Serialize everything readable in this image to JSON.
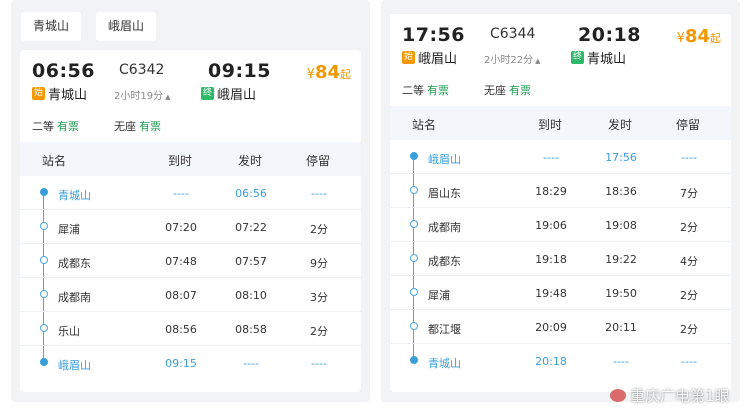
{
  "left": {
    "chips": [
      "青城山",
      "峨眉山"
    ],
    "depart_time": "06:56",
    "train_no": "C6342",
    "arrive_time": "09:15",
    "duration": "2小时19分",
    "price": {
      "symbol": "¥",
      "amount": "84",
      "suffix": "起"
    },
    "from_station": "青城山",
    "from_badge": "始",
    "to_station": "峨眉山",
    "to_badge": "终",
    "seats": [
      {
        "label": "二等",
        "status": "有票"
      },
      {
        "label": "无座",
        "status": "有票"
      }
    ],
    "headers": {
      "name": "站名",
      "arrive": "到时",
      "depart": "发时",
      "stay": "停留"
    },
    "stops": [
      {
        "name": "青城山",
        "arrive": "----",
        "depart": "06:56",
        "stay": "----"
      },
      {
        "name": "犀浦",
        "arrive": "07:20",
        "depart": "07:22",
        "stay": "2分"
      },
      {
        "name": "成都东",
        "arrive": "07:48",
        "depart": "07:57",
        "stay": "9分"
      },
      {
        "name": "成都南",
        "arrive": "08:07",
        "depart": "08:10",
        "stay": "3分"
      },
      {
        "name": "乐山",
        "arrive": "08:56",
        "depart": "08:58",
        "stay": "2分"
      },
      {
        "name": "峨眉山",
        "arrive": "09:15",
        "depart": "----",
        "stay": "----"
      }
    ]
  },
  "right": {
    "depart_time": "17:56",
    "train_no": "C6344",
    "arrive_time": "20:18",
    "duration": "2小时22分",
    "price": {
      "symbol": "¥",
      "amount": "84",
      "suffix": "起"
    },
    "from_station": "峨眉山",
    "from_badge": "始",
    "to_station": "青城山",
    "to_badge": "终",
    "seats": [
      {
        "label": "二等",
        "status": "有票"
      },
      {
        "label": "无座",
        "status": "有票"
      }
    ],
    "headers": {
      "name": "站名",
      "arrive": "到时",
      "depart": "发时",
      "stay": "停留"
    },
    "stops": [
      {
        "name": "峨眉山",
        "arrive": "----",
        "depart": "17:56",
        "stay": "----"
      },
      {
        "name": "眉山东",
        "arrive": "18:29",
        "depart": "18:36",
        "stay": "7分"
      },
      {
        "name": "成都南",
        "arrive": "19:06",
        "depart": "19:08",
        "stay": "2分"
      },
      {
        "name": "成都东",
        "arrive": "19:18",
        "depart": "19:22",
        "stay": "4分"
      },
      {
        "name": "犀浦",
        "arrive": "19:48",
        "depart": "19:50",
        "stay": "2分"
      },
      {
        "name": "都江堰",
        "arrive": "20:09",
        "depart": "20:11",
        "stay": "2分"
      },
      {
        "name": "青城山",
        "arrive": "20:18",
        "depart": "----",
        "stay": "----"
      }
    ]
  },
  "watermark": "重庆广电第1眼",
  "colors": {
    "accent_blue": "#3a9fd9",
    "price_orange": "#f39800",
    "ticket_green": "#1e9e55"
  }
}
